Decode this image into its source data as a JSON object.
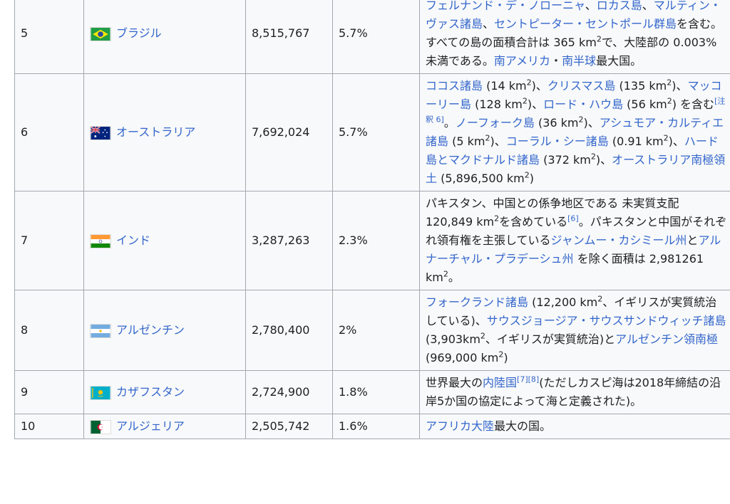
{
  "rows": [
    {
      "rank": "5",
      "country": "ブラジル",
      "flag": "brazil-flag-icon",
      "area": "8,515,767",
      "pct": "5.7%",
      "notes": [
        {
          "t": "フェルナンド・デ・ノローニャ",
          "l": true
        },
        {
          "t": "、",
          "l": false
        },
        {
          "t": "ロカス島",
          "l": true
        },
        {
          "t": "、",
          "l": false
        },
        {
          "t": "マルティン・ヴァス諸島",
          "l": true
        },
        {
          "t": "、",
          "l": false
        },
        {
          "t": "セントピーター・セントポール群島",
          "l": true
        },
        {
          "t": "を含む。すべての島の面積合計は 365 km",
          "l": false
        },
        {
          "t": "2",
          "sup": true
        },
        {
          "t": "で、大陸部の 0.003% 未満である。",
          "l": false
        },
        {
          "t": "南アメリカ",
          "l": true
        },
        {
          "t": "・",
          "l": false
        },
        {
          "t": "南半球",
          "l": true
        },
        {
          "t": "最大国。",
          "l": false
        }
      ]
    },
    {
      "rank": "6",
      "country": "オーストラリア",
      "flag": "australia-flag-icon",
      "area": "7,692,024",
      "pct": "5.7%",
      "notes": [
        {
          "t": "ココス諸島",
          "l": true
        },
        {
          "t": " (14 km",
          "l": false
        },
        {
          "t": "2",
          "sup": true
        },
        {
          "t": ")、",
          "l": false
        },
        {
          "t": "クリスマス島",
          "l": true
        },
        {
          "t": " (135 km",
          "l": false
        },
        {
          "t": "2",
          "sup": true
        },
        {
          "t": ")、",
          "l": false
        },
        {
          "t": "マッコーリー島",
          "l": true
        },
        {
          "t": " (128 km",
          "l": false
        },
        {
          "t": "2",
          "sup": true
        },
        {
          "t": ")、",
          "l": false
        },
        {
          "t": "ロード・ハウ島",
          "l": true
        },
        {
          "t": " (56 km",
          "l": false
        },
        {
          "t": "2",
          "sup": true
        },
        {
          "t": ") を含む",
          "l": false
        },
        {
          "t": "[注釈 6]",
          "sup": true,
          "l": true
        },
        {
          "t": "。",
          "l": false
        },
        {
          "t": "ノーフォーク島",
          "l": true
        },
        {
          "t": " (36 km",
          "l": false
        },
        {
          "t": "2",
          "sup": true
        },
        {
          "t": ")、",
          "l": false
        },
        {
          "t": "アシュモア・カルティエ諸島",
          "l": true
        },
        {
          "t": " (5 km",
          "l": false
        },
        {
          "t": "2",
          "sup": true
        },
        {
          "t": ")、",
          "l": false
        },
        {
          "t": "コーラル・シー諸島",
          "l": true
        },
        {
          "t": " (0.91 km",
          "l": false
        },
        {
          "t": "2",
          "sup": true
        },
        {
          "t": ")、",
          "l": false
        },
        {
          "t": "ハード島とマクドナルド諸島",
          "l": true
        },
        {
          "t": " (372 km",
          "l": false
        },
        {
          "t": "2",
          "sup": true
        },
        {
          "t": ")、",
          "l": false
        },
        {
          "t": "オーストラリア南極領土",
          "l": true
        },
        {
          "t": " (5,896,500 km",
          "l": false
        },
        {
          "t": "2",
          "sup": true
        },
        {
          "t": ")",
          "l": false
        }
      ]
    },
    {
      "rank": "7",
      "country": "インド",
      "flag": "india-flag-icon",
      "area": "3,287,263",
      "pct": "2.3%",
      "notes": [
        {
          "t": "パキスタン、中国との係争地区である 未実質支配 120,849 km",
          "l": false
        },
        {
          "t": "2",
          "sup": true
        },
        {
          "t": "を含めている",
          "l": false
        },
        {
          "t": "[6]",
          "sup": true,
          "l": true
        },
        {
          "t": "。パキスタンと中国がそれぞれ領有権を主張している",
          "l": false
        },
        {
          "t": "ジャンムー・カシミール州",
          "l": true
        },
        {
          "t": "と",
          "l": false
        },
        {
          "t": "アルナーチャル・プラデーシュ州",
          "l": true
        },
        {
          "t": " を除く面積は 2,981261 km",
          "l": false
        },
        {
          "t": "2",
          "sup": true
        },
        {
          "t": "。",
          "l": false
        }
      ]
    },
    {
      "rank": "8",
      "country": "アルゼンチン",
      "flag": "argentina-flag-icon",
      "area": "2,780,400",
      "pct": "2%",
      "notes": [
        {
          "t": "フォークランド諸島",
          "l": true
        },
        {
          "t": " (12,200 km",
          "l": false
        },
        {
          "t": "2",
          "sup": true
        },
        {
          "t": "、イギリスが実質統治している)、",
          "l": false
        },
        {
          "t": "サウスジョージア・サウスサンドウィッチ諸島",
          "l": true
        },
        {
          "t": "(3,903km",
          "l": false
        },
        {
          "t": "2",
          "sup": true
        },
        {
          "t": "、イギリスが実質統治)と",
          "l": false
        },
        {
          "t": "アルゼンチン領南極",
          "l": true
        },
        {
          "t": " (969,000 km",
          "l": false
        },
        {
          "t": "2",
          "sup": true
        },
        {
          "t": ")",
          "l": false
        }
      ]
    },
    {
      "rank": "9",
      "country": "カザフスタン",
      "flag": "kazakhstan-flag-icon",
      "area": "2,724,900",
      "pct": "1.8%",
      "notes": [
        {
          "t": "世界最大の",
          "l": false
        },
        {
          "t": "内陸国",
          "l": true
        },
        {
          "t": "[7]",
          "sup": true,
          "l": true
        },
        {
          "t": "[8]",
          "sup": true,
          "l": true
        },
        {
          "t": "(ただしカスピ海は2018年締結の沿岸5か国の協定によって海と定義された)。",
          "l": false
        }
      ]
    },
    {
      "rank": "10",
      "country": "アルジェリア",
      "flag": "algeria-flag-icon",
      "area": "2,505,742",
      "pct": "1.6%",
      "notes": [
        {
          "t": "アフリカ大陸",
          "l": true
        },
        {
          "t": "最大の国。",
          "l": false
        }
      ]
    }
  ],
  "colors": {
    "link": "#3366cc",
    "border": "#a2a9b1",
    "cell_bg": "#f8f9fa"
  }
}
